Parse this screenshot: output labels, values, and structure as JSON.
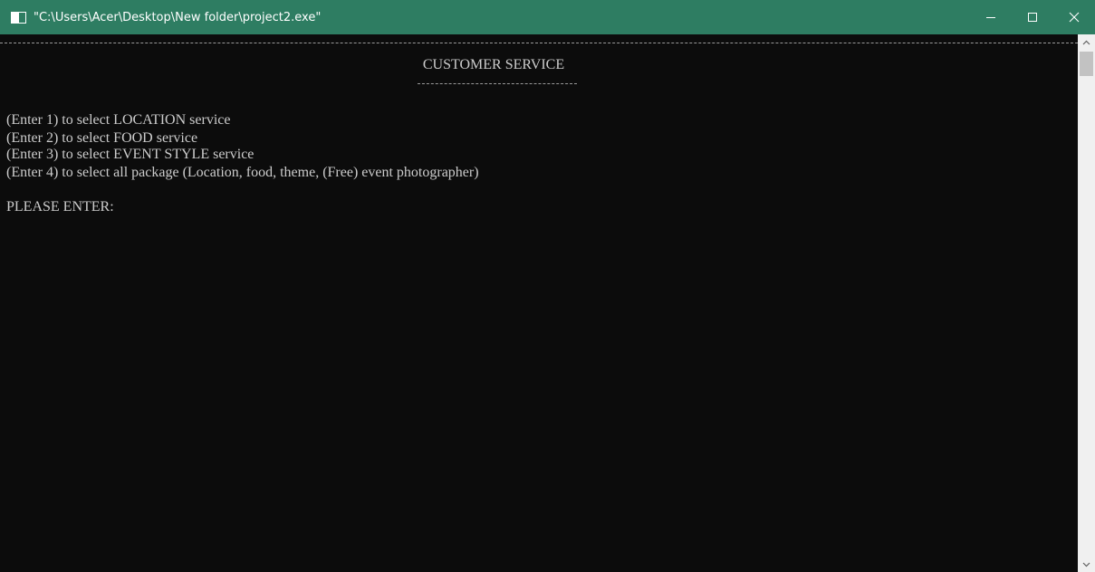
{
  "window": {
    "title": "\"C:\\Users\\Acer\\Desktop\\New folder\\project2.exe\"",
    "icon": "console-app-icon",
    "controls": {
      "minimize": "minimize-icon",
      "maximize": "maximize-icon",
      "close": "close-icon"
    }
  },
  "console": {
    "heading": "CUSTOMER SERVICE",
    "menu": [
      "(Enter 1) to select LOCATION service",
      "(Enter 2) to select FOOD service",
      "(Enter 3) to select EVENT STYLE service",
      "(Enter 4) to select all package (Location, food, theme, (Free) event photographer)"
    ],
    "prompt": "PLEASE ENTER:"
  },
  "scrollbar": {
    "up": "scroll-up-arrow-icon",
    "down": "scroll-down-arrow-icon"
  },
  "colors": {
    "titlebar": "#2e7d62",
    "console_bg": "#0c0c0c",
    "console_text": "#cccccc",
    "scrollbar_bg": "#f0f0f0"
  }
}
